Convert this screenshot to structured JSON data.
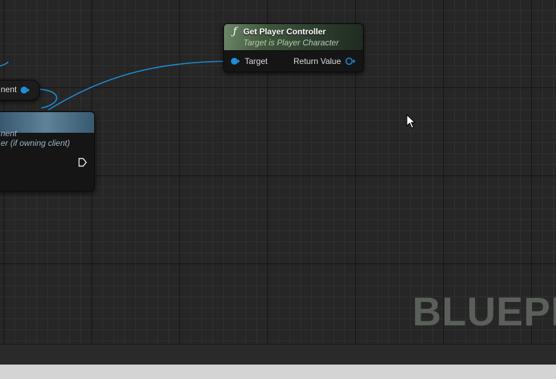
{
  "graph": {
    "watermark": "BLUEPR",
    "get_player_controller_node": {
      "title": "Get Player Controller",
      "subtitle": "Target is Player Character",
      "input_pin_label": "Target",
      "output_pin_label": "Return Value"
    },
    "partial_node_top": {
      "visible_label": "nent"
    },
    "partial_node_left": {
      "visible_title_fragment": "nent",
      "visible_subtitle_fragment": "er (if owning client)"
    }
  },
  "colors": {
    "object_wire": "#1e8fd8",
    "grid_bg": "#262626",
    "function_header": "#4f6a4b",
    "left_node_header": "#4f7690"
  },
  "icons": {
    "function": "f-icon",
    "exec_output": "exec-pin-icon",
    "cursor": "mouse-pointer-icon"
  }
}
